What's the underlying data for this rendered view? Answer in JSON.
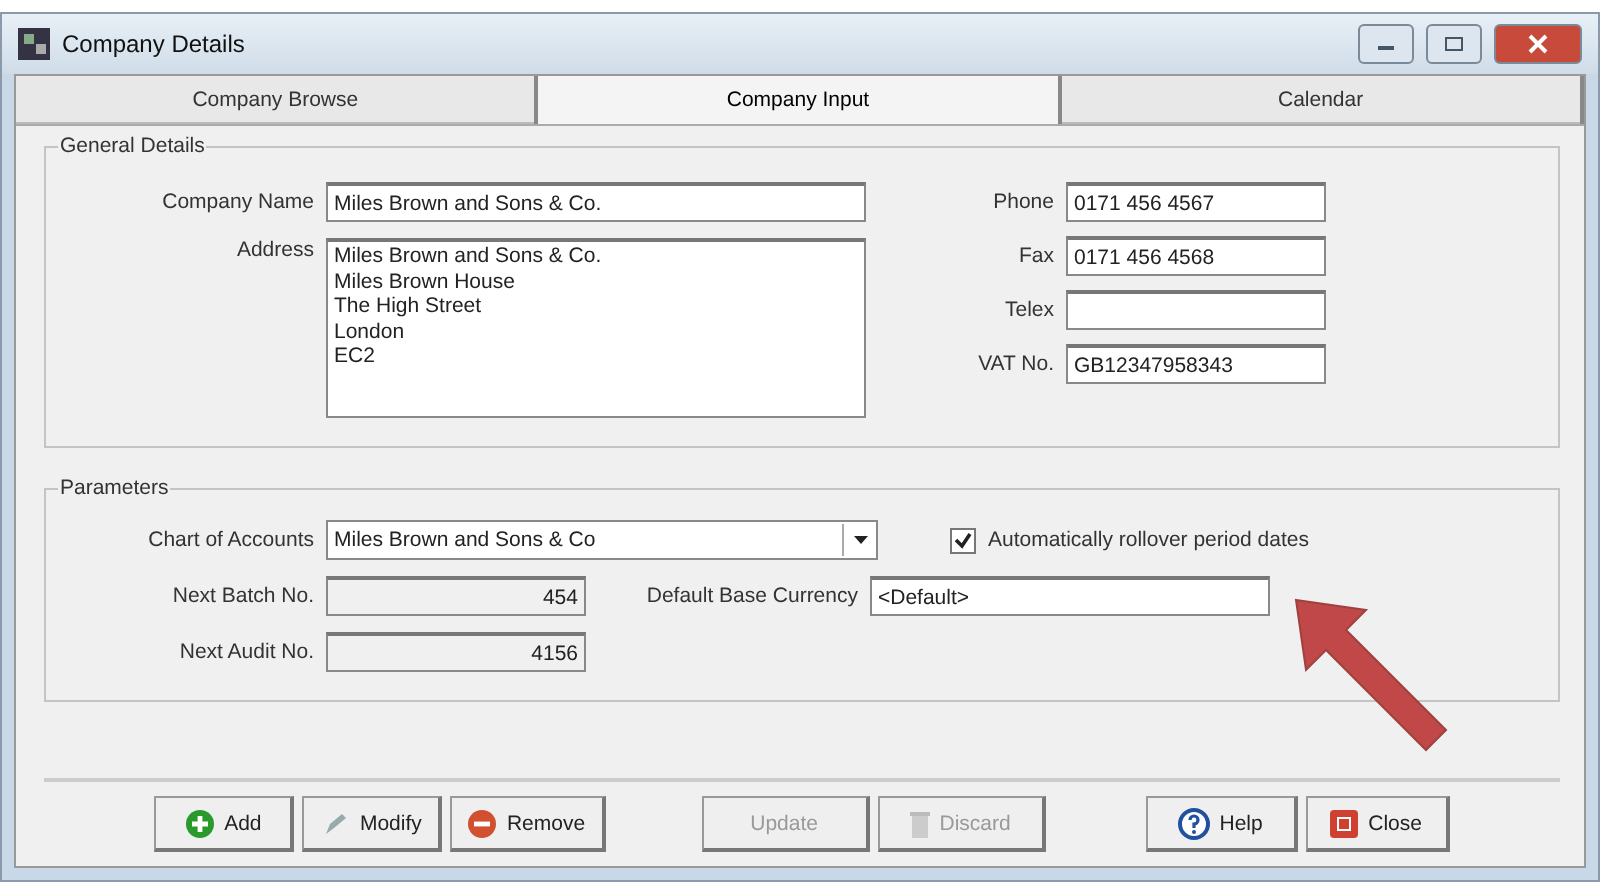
{
  "window": {
    "title": "Company Details"
  },
  "tabs": [
    {
      "label": "Company Browse",
      "selected": false
    },
    {
      "label": "Company Input",
      "selected": true
    },
    {
      "label": "Calendar",
      "selected": false
    }
  ],
  "general_details": {
    "title": "General Details",
    "company_name": {
      "label": "Company Name",
      "value": "Miles Brown and Sons & Co."
    },
    "address": {
      "label": "Address",
      "lines": [
        "Miles Brown and Sons & Co.",
        "Miles Brown House",
        "The High Street",
        "London",
        "EC2"
      ]
    },
    "contacts": [
      {
        "label": "Phone",
        "value": "0171 456 4567"
      },
      {
        "label": "Fax",
        "value": "0171 456 4568"
      },
      {
        "label": "Telex"
      },
      {
        "label": "VAT No.",
        "value": "GB12347958343"
      }
    ]
  },
  "parameters": {
    "title": "Parameters",
    "chart_of_accounts": {
      "label": "Chart of Accounts",
      "value": "Miles Brown and Sons & Co"
    },
    "rollover": {
      "label": "Automatically rollover period dates",
      "checked": true
    },
    "next_batch": {
      "label": "Next Batch No.",
      "value": "454"
    },
    "next_audit": {
      "label": "Next Audit No.",
      "value": "4156"
    },
    "currency": {
      "label": "Default Base Currency",
      "value": "<Default>"
    }
  },
  "buttons": [
    {
      "label": "Add",
      "kind": "add",
      "disabled": false
    },
    {
      "label": "Modify",
      "kind": "modify",
      "disabled": false
    },
    {
      "label": "Remove",
      "kind": "remove",
      "disabled": false
    },
    {
      "label": "Update",
      "kind": "update",
      "disabled": true
    },
    {
      "label": "Discard",
      "kind": "discard",
      "disabled": true
    },
    {
      "label": "Help",
      "kind": "help",
      "disabled": false
    },
    {
      "label": "Close",
      "kind": "close",
      "disabled": false
    }
  ]
}
